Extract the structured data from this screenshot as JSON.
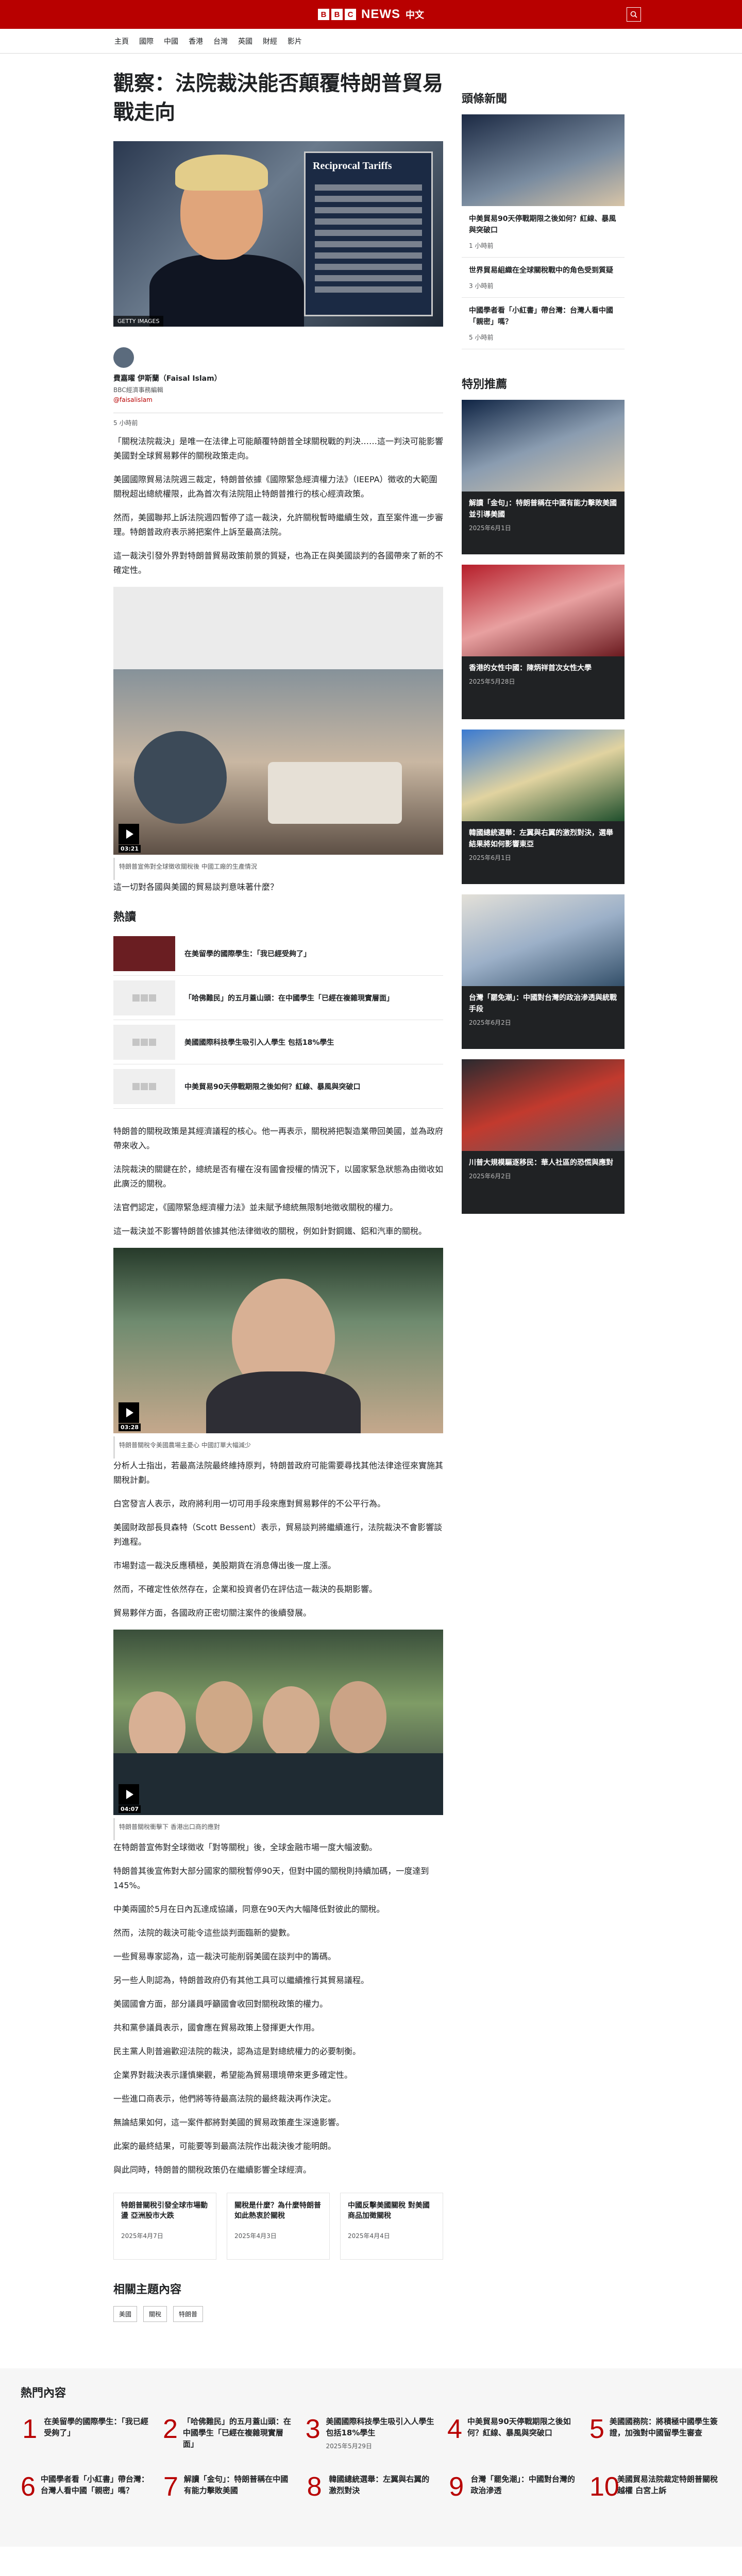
{
  "header": {
    "brand_letters": [
      "B",
      "B",
      "C"
    ],
    "brand_news": "NEWS",
    "brand_lang": "中文",
    "search_icon": "search-icon"
  },
  "nav": [
    "主頁",
    "國際",
    "中國",
    "香港",
    "台灣",
    "英國",
    "財經",
    "影片"
  ],
  "article": {
    "headline": "觀察：法院裁決能否顛覆特朗普貿易戰走向",
    "hero_caption": "GETTY IMAGES",
    "hero_board_text": "Reciprocal Tariffs",
    "author_name": "費嘉曜 伊斯蘭（Faisal Islam）",
    "author_role": "BBC經濟事務編輯",
    "author_handle": "@faisalislam",
    "date": "5 小時前",
    "paragraphs_1": [
      "「關稅法院裁決」是唯一在法律上可能顛覆特朗普全球關稅戰的判決……這一判決可能影響美國對全球貿易夥伴的關稅政策走向。",
      "美國國際貿易法院週三裁定，特朗普依據《國際緊急經濟權力法》（IEEPA）徵收的大範圍關稅超出總統權限，此為首次有法院阻止特朗普推行的核心經濟政策。",
      "然而，美國聯邦上訴法院週四暫停了這一裁決，允許關稅暫時繼續生效，直至案件進一步審理。特朗普政府表示將把案件上訴至最高法院。",
      "這一裁決引發外界對特朗普貿易政策前景的質疑，也為正在與美國談判的各國帶來了新的不確定性。"
    ],
    "video1_duration": "03:21",
    "video1_caption": "特朗普宣佈對全球徵收關稅後 中國工廠的生產情況",
    "paragraph_after_video1": "這一切對各國與美國的貿易談判意味著什麼？"
  },
  "hot": {
    "title": "熱讀",
    "items": [
      "在美留學的國際學生：「我已經受夠了」",
      "「哈佛難民」的五月蓋山頭：在中國學生「已經在複雜現實層面」",
      "美國國際科技學生吸引入人學生 包括18%學生",
      "中美貿易90天停戰期限之後如何？紅線、暴風與突破口"
    ]
  },
  "article_more": {
    "paragraphs_2": [
      "特朗普的關稅政策是其經濟議程的核心。他一再表示，關稅將把製造業帶回美國，並為政府帶來收入。",
      "法院裁決的關鍵在於，總統是否有權在沒有國會授權的情況下，以國家緊急狀態為由徵收如此廣泛的關稅。",
      "法官們認定，《國際緊急經濟權力法》並未賦予總統無限制地徵收關稅的權力。",
      "這一裁決並不影響特朗普依據其他法律徵收的關稅，例如針對鋼鐵、鋁和汽車的關稅。"
    ],
    "video2_duration": "03:28",
    "video2_caption": "特朗普關稅令美國農場主憂心 中國訂單大幅減少",
    "paragraphs_3": [
      "分析人士指出，若最高法院最終維持原判，特朗普政府可能需要尋找其他法律途徑來實施其關稅計劃。",
      "白宮發言人表示，政府將利用一切可用手段來應對貿易夥伴的不公平行為。",
      "美國財政部長貝森特（Scott Bessent）表示，貿易談判將繼續進行，法院裁決不會影響談判進程。",
      "市場對這一裁決反應積極，美股期貨在消息傳出後一度上漲。",
      "然而，不確定性依然存在，企業和投資者仍在評估這一裁決的長期影響。",
      "貿易夥伴方面，各國政府正密切關注案件的後續發展。"
    ],
    "video3_duration": "04:07",
    "video3_caption": "特朗普關稅衝擊下 香港出口商的應對",
    "paragraphs_4": [
      "在特朗普宣佈對全球徵收「對等關稅」後，全球金融市場一度大幅波動。",
      "特朗普其後宣佈對大部分國家的關稅暫停90天，但對中國的關稅則持續加碼，一度達到145%。",
      "中美兩國於5月在日內瓦達成協議，同意在90天內大幅降低對彼此的關稅。",
      "然而，法院的裁決可能令這些談判面臨新的變數。",
      "一些貿易專家認為，這一裁決可能削弱美國在談判中的籌碼。",
      "另一些人則認為，特朗普政府仍有其他工具可以繼續推行其貿易議程。",
      "美國國會方面，部分議員呼籲國會收回對關稅政策的權力。",
      "共和黨參議員表示，國會應在貿易政策上發揮更大作用。",
      "民主黨人則普遍歡迎法院的裁決，認為這是對總統權力的必要制衡。",
      "企業界對裁決表示謹慎樂觀，希望能為貿易環境帶來更多確定性。",
      "一些進口商表示，他們將等待最高法院的最終裁決再作決定。",
      "無論結果如何，這一案件都將對美國的貿易政策產生深遠影響。",
      "此案的最終結果，可能要等到最高法院作出裁決後才能明朗。",
      "與此同時，特朗普的關稅政策仍在繼續影響全球經濟。"
    ],
    "related_cards": [
      {
        "title": "特朗普關稅引發全球市場動盪 亞洲股市大跌",
        "date": "2025年4月7日"
      },
      {
        "title": "關稅是什麼？為什麼特朗普如此熱衷於關稅",
        "date": "2025年4月3日"
      },
      {
        "title": "中國反擊美國關稅 對美國商品加徵關稅",
        "date": "2025年4月4日"
      }
    ]
  },
  "topics": {
    "title": "相關主題內容",
    "tags": [
      "美國",
      "關稅",
      "特朗普"
    ]
  },
  "sidebar": {
    "latest_title": "頭條新聞",
    "latest": [
      {
        "title": "中美貿易90天停戰期限之後如何？紅線、暴風與突破口",
        "date": "1 小時前"
      },
      {
        "title": "世界貿易組織在全球關稅戰中的角色受到質疑",
        "date": "3 小時前"
      },
      {
        "title": "中國學者看「小紅書」帶台灣：台灣人看中國「親密」嗎？",
        "date": "5 小時前"
      }
    ],
    "special_title": "特別推薦",
    "special": [
      {
        "title": "解讀「金句」：特朗普稱在中國有能力擊敗美國並引導美國",
        "date": "2025年6月1日"
      },
      {
        "title": "香港的女性中國：陳炳祥首次女性大學",
        "date": "2025年5月28日"
      },
      {
        "title": "韓國總統選舉：左翼與右翼的激烈對決，選舉結果將如何影響東亞",
        "date": "2025年6月1日"
      },
      {
        "title": "台灣「罷免潮」：中國對台灣的政治滲透與統戰手段",
        "date": "2025年6月2日"
      },
      {
        "title": "川普大規模驅逐移民：華人社區的恐慌與應對",
        "date": "2025年6月2日"
      }
    ]
  },
  "popular": {
    "title": "熱門內容",
    "items": [
      {
        "n": "1",
        "title": "在美留學的國際學生：「我已經受夠了」",
        "date": ""
      },
      {
        "n": "2",
        "title": "「哈佛難民」的五月蓋山頭：在中國學生「已經在複雜現實層面」",
        "date": ""
      },
      {
        "n": "3",
        "title": "美國國際科技學生吸引入人學生 包括18%學生",
        "date": "2025年5月29日"
      },
      {
        "n": "4",
        "title": "中美貿易90天停戰期限之後如何？紅線、暴風與突破口",
        "date": ""
      },
      {
        "n": "5",
        "title": "美國國務院：將積極中國學生簽證，加強對中國留學生審查",
        "date": ""
      },
      {
        "n": "6",
        "title": "中國學者看「小紅書」帶台灣：台灣人看中國「親密」嗎？",
        "date": ""
      },
      {
        "n": "7",
        "title": "解讀「金句」：特朗普稱在中國有能力擊敗美國",
        "date": ""
      },
      {
        "n": "8",
        "title": "韓國總統選舉：左翼與右翼的激烈對決",
        "date": ""
      },
      {
        "n": "9",
        "title": "台灣「罷免潮」：中國對台灣的政治滲透",
        "date": ""
      },
      {
        "n": "10",
        "title": "美國貿易法院裁定特朗普關稅越權 白宮上訴",
        "date": ""
      }
    ]
  }
}
